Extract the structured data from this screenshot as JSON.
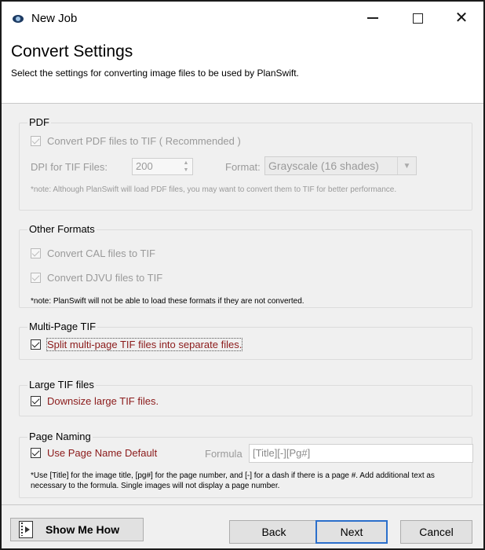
{
  "window": {
    "title": "New Job"
  },
  "title_controls": {
    "minimize": "—",
    "maximize": "☐",
    "close": "✕"
  },
  "header": {
    "title": "Convert Settings",
    "subtitle": "Select the settings for converting image files to be used by PlanSwift."
  },
  "pdf": {
    "group_label": "PDF",
    "convert_label": "Convert PDF files to TIF  ( Recommended )",
    "convert_checked": true,
    "dpi_label": "DPI for TIF Files:",
    "dpi_value": "200",
    "format_label": "Format:",
    "format_value": "Grayscale (16 shades)",
    "note": "*note:  Although PlanSwift will load PDF files, you may want to convert them to TIF for better performance."
  },
  "other_formats": {
    "group_label": "Other Formats",
    "cal_label": "Convert CAL files to TIF",
    "cal_checked": true,
    "djvu_label": "Convert DJVU files to TIF",
    "djvu_checked": true,
    "note": "*note: PlanSwift will not be able to load these formats if they are not converted."
  },
  "multipage": {
    "group_label": "Multi-Page TIF",
    "split_label": "Split multi-page TIF files into separate files.",
    "split_checked": true
  },
  "large_tif": {
    "group_label": "Large TIF files",
    "downsize_label": "Downsize large TIF files.",
    "downsize_checked": true
  },
  "page_naming": {
    "group_label": "Page Naming",
    "default_label": "Use Page Name Default",
    "default_checked": true,
    "formula_label": "Formula",
    "formula_value": "[Title][-][Pg#]",
    "note": "*Use [Title] for the image title, [pg#] for the page number, and [-] for a dash if there is a page #.  Add additional text as necessary to the formula.  Single images will not display a page number."
  },
  "footer": {
    "show_me_how": "Show Me How",
    "back": "Back",
    "next": "Next",
    "cancel": "Cancel"
  },
  "colors": {
    "accent": "#2b6fcb",
    "label_red": "#8b1a1a",
    "disabled": "#9a9a9a"
  }
}
